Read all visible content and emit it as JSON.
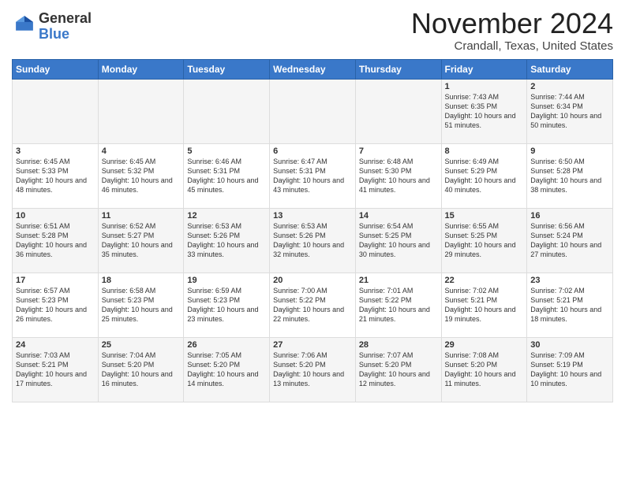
{
  "header": {
    "logo": {
      "general": "General",
      "blue": "Blue"
    },
    "title": "November 2024",
    "location": "Crandall, Texas, United States"
  },
  "weekdays": [
    "Sunday",
    "Monday",
    "Tuesday",
    "Wednesday",
    "Thursday",
    "Friday",
    "Saturday"
  ],
  "weeks": [
    [
      {
        "day": "",
        "info": ""
      },
      {
        "day": "",
        "info": ""
      },
      {
        "day": "",
        "info": ""
      },
      {
        "day": "",
        "info": ""
      },
      {
        "day": "",
        "info": ""
      },
      {
        "day": "1",
        "info": "Sunrise: 7:43 AM\nSunset: 6:35 PM\nDaylight: 10 hours and 51 minutes."
      },
      {
        "day": "2",
        "info": "Sunrise: 7:44 AM\nSunset: 6:34 PM\nDaylight: 10 hours and 50 minutes."
      }
    ],
    [
      {
        "day": "3",
        "info": "Sunrise: 6:45 AM\nSunset: 5:33 PM\nDaylight: 10 hours and 48 minutes."
      },
      {
        "day": "4",
        "info": "Sunrise: 6:45 AM\nSunset: 5:32 PM\nDaylight: 10 hours and 46 minutes."
      },
      {
        "day": "5",
        "info": "Sunrise: 6:46 AM\nSunset: 5:31 PM\nDaylight: 10 hours and 45 minutes."
      },
      {
        "day": "6",
        "info": "Sunrise: 6:47 AM\nSunset: 5:31 PM\nDaylight: 10 hours and 43 minutes."
      },
      {
        "day": "7",
        "info": "Sunrise: 6:48 AM\nSunset: 5:30 PM\nDaylight: 10 hours and 41 minutes."
      },
      {
        "day": "8",
        "info": "Sunrise: 6:49 AM\nSunset: 5:29 PM\nDaylight: 10 hours and 40 minutes."
      },
      {
        "day": "9",
        "info": "Sunrise: 6:50 AM\nSunset: 5:28 PM\nDaylight: 10 hours and 38 minutes."
      }
    ],
    [
      {
        "day": "10",
        "info": "Sunrise: 6:51 AM\nSunset: 5:28 PM\nDaylight: 10 hours and 36 minutes."
      },
      {
        "day": "11",
        "info": "Sunrise: 6:52 AM\nSunset: 5:27 PM\nDaylight: 10 hours and 35 minutes."
      },
      {
        "day": "12",
        "info": "Sunrise: 6:53 AM\nSunset: 5:26 PM\nDaylight: 10 hours and 33 minutes."
      },
      {
        "day": "13",
        "info": "Sunrise: 6:53 AM\nSunset: 5:26 PM\nDaylight: 10 hours and 32 minutes."
      },
      {
        "day": "14",
        "info": "Sunrise: 6:54 AM\nSunset: 5:25 PM\nDaylight: 10 hours and 30 minutes."
      },
      {
        "day": "15",
        "info": "Sunrise: 6:55 AM\nSunset: 5:25 PM\nDaylight: 10 hours and 29 minutes."
      },
      {
        "day": "16",
        "info": "Sunrise: 6:56 AM\nSunset: 5:24 PM\nDaylight: 10 hours and 27 minutes."
      }
    ],
    [
      {
        "day": "17",
        "info": "Sunrise: 6:57 AM\nSunset: 5:23 PM\nDaylight: 10 hours and 26 minutes."
      },
      {
        "day": "18",
        "info": "Sunrise: 6:58 AM\nSunset: 5:23 PM\nDaylight: 10 hours and 25 minutes."
      },
      {
        "day": "19",
        "info": "Sunrise: 6:59 AM\nSunset: 5:23 PM\nDaylight: 10 hours and 23 minutes."
      },
      {
        "day": "20",
        "info": "Sunrise: 7:00 AM\nSunset: 5:22 PM\nDaylight: 10 hours and 22 minutes."
      },
      {
        "day": "21",
        "info": "Sunrise: 7:01 AM\nSunset: 5:22 PM\nDaylight: 10 hours and 21 minutes."
      },
      {
        "day": "22",
        "info": "Sunrise: 7:02 AM\nSunset: 5:21 PM\nDaylight: 10 hours and 19 minutes."
      },
      {
        "day": "23",
        "info": "Sunrise: 7:02 AM\nSunset: 5:21 PM\nDaylight: 10 hours and 18 minutes."
      }
    ],
    [
      {
        "day": "24",
        "info": "Sunrise: 7:03 AM\nSunset: 5:21 PM\nDaylight: 10 hours and 17 minutes."
      },
      {
        "day": "25",
        "info": "Sunrise: 7:04 AM\nSunset: 5:20 PM\nDaylight: 10 hours and 16 minutes."
      },
      {
        "day": "26",
        "info": "Sunrise: 7:05 AM\nSunset: 5:20 PM\nDaylight: 10 hours and 14 minutes."
      },
      {
        "day": "27",
        "info": "Sunrise: 7:06 AM\nSunset: 5:20 PM\nDaylight: 10 hours and 13 minutes."
      },
      {
        "day": "28",
        "info": "Sunrise: 7:07 AM\nSunset: 5:20 PM\nDaylight: 10 hours and 12 minutes."
      },
      {
        "day": "29",
        "info": "Sunrise: 7:08 AM\nSunset: 5:20 PM\nDaylight: 10 hours and 11 minutes."
      },
      {
        "day": "30",
        "info": "Sunrise: 7:09 AM\nSunset: 5:19 PM\nDaylight: 10 hours and 10 minutes."
      }
    ]
  ]
}
